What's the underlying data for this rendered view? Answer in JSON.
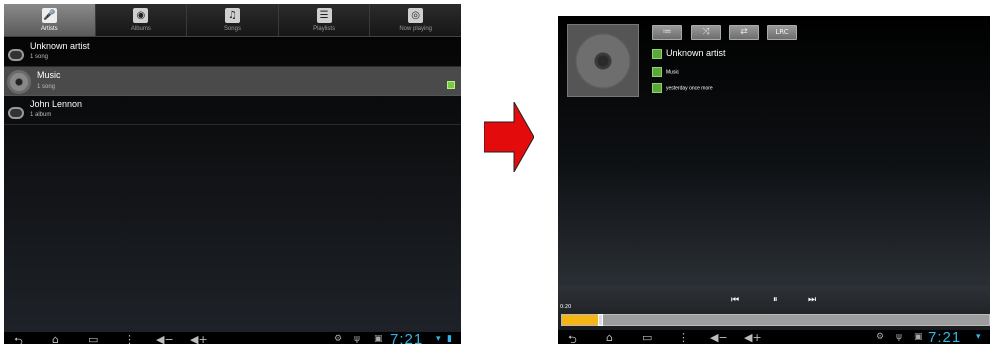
{
  "left_screen": {
    "tabs": [
      {
        "label": "Artists",
        "icon": "microphone-icon",
        "active": true
      },
      {
        "label": "Albums",
        "icon": "album-icon",
        "active": false
      },
      {
        "label": "Songs",
        "icon": "music-note-icon",
        "active": false
      },
      {
        "label": "Playlists",
        "icon": "playlist-icon",
        "active": false
      },
      {
        "label": "Now playing",
        "icon": "now-playing-icon",
        "active": false
      }
    ],
    "rows": [
      {
        "title": "Unknown artist",
        "subtitle": "1 song"
      },
      {
        "title": "Music",
        "subtitle": "1 song",
        "selected": true
      },
      {
        "title": "John Lennon",
        "subtitle": "1 album"
      }
    ],
    "clock": "7:21"
  },
  "right_screen": {
    "control_buttons": [
      {
        "name": "list-button",
        "label": "≔"
      },
      {
        "name": "shuffle-button",
        "label": "⤨"
      },
      {
        "name": "repeat-button",
        "label": "⇄"
      },
      {
        "name": "lyrics-button",
        "label": "LRC"
      }
    ],
    "artist": "Unknown artist",
    "album": "Music",
    "song": "yesterday once more",
    "elapsed": "0:20",
    "progress_fraction": 0.09,
    "playback": {
      "prev": "⏮",
      "pause": "⏸",
      "next": "⏭"
    },
    "clock": "7:21"
  },
  "colors": {
    "accent_clock": "#33b5e5",
    "progress": "#f5b614",
    "arrow": "#e30b0b"
  }
}
